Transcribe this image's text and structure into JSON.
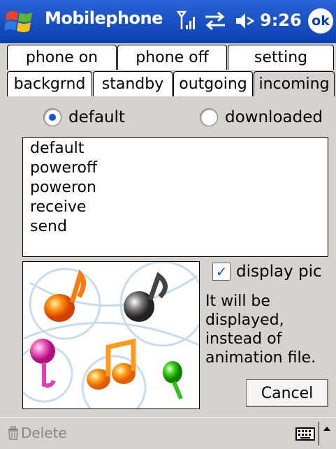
{
  "titlebar": {
    "app_title": "Mobilephone",
    "time": "9:26",
    "ok_label": "ok",
    "icons": [
      "windows-start-icon",
      "signal-icon",
      "sync-icon",
      "volume-icon"
    ]
  },
  "tabs": {
    "row1": [
      "phone on",
      "phone off",
      "setting"
    ],
    "row2": [
      "backgrnd",
      "standby",
      "outgoing",
      "incoming"
    ],
    "selected": "incoming"
  },
  "source": {
    "options": [
      "default",
      "downloaded"
    ],
    "selected": "default"
  },
  "sound_list": [
    "default",
    "poweroff",
    "poweron",
    "receive",
    "send"
  ],
  "display_pic": {
    "label": "display pic",
    "checked": true,
    "note": "It will be displayed, instead of animation file."
  },
  "buttons": {
    "cancel": "Cancel"
  },
  "menubar": {
    "delete": "Delete",
    "icons": [
      "keyboard-icon",
      "up-arrow-icon"
    ]
  },
  "colors": {
    "titlebar": "#0b3fb0",
    "background": "#d6d3ce",
    "accent": "#1a4fd8"
  }
}
